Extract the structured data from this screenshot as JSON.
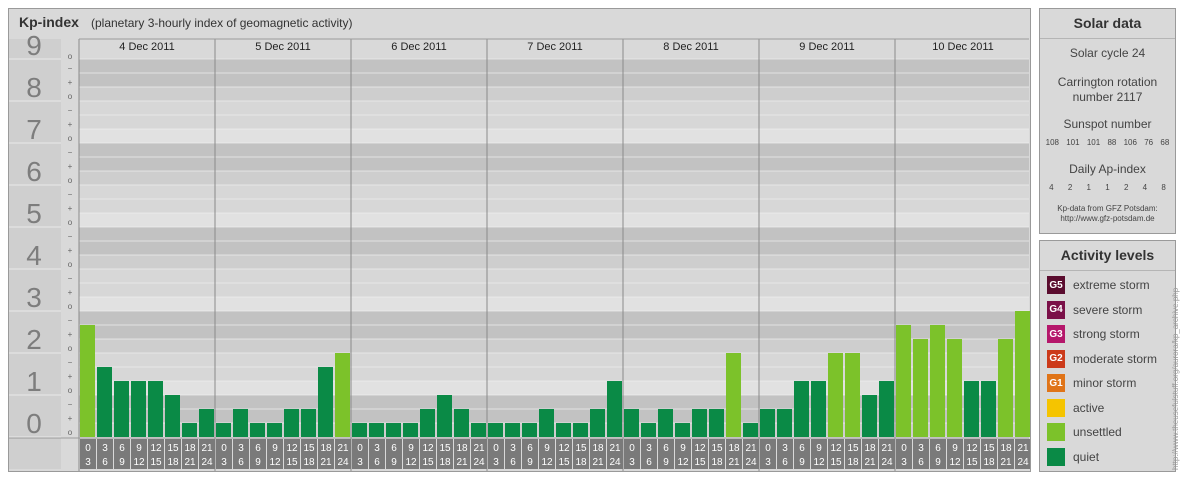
{
  "header": {
    "title": "Kp-index",
    "subtitle": "(planetary 3-hourly index of geomagnetic activity)"
  },
  "chart_data": {
    "type": "bar",
    "title": "Kp-index",
    "subtitle": "(planetary 3-hourly index of geomagnetic activity)",
    "ylim": [
      0,
      9
    ],
    "y_major_ticks": [
      "0",
      "1",
      "2",
      "3",
      "4",
      "5",
      "6",
      "7",
      "8",
      "9"
    ],
    "y_minor_ticks": [
      "o",
      "+",
      "−"
    ],
    "days": [
      "4 Dec 2011",
      "5 Dec 2011",
      "6 Dec 2011",
      "7 Dec 2011",
      "8 Dec 2011",
      "9 Dec 2011",
      "10 Dec 2011"
    ],
    "interval_start": [
      "0",
      "3",
      "6",
      "9",
      "12",
      "15",
      "18",
      "21"
    ],
    "interval_end": [
      "3",
      "6",
      "9",
      "12",
      "15",
      "18",
      "21",
      "24"
    ],
    "values": [
      [
        2.667,
        1.667,
        1.333,
        1.333,
        1.333,
        1.0,
        0.333,
        0.667
      ],
      [
        0.333,
        0.667,
        0.333,
        0.333,
        0.667,
        0.667,
        1.667,
        2.0
      ],
      [
        0.333,
        0.333,
        0.333,
        0.333,
        0.667,
        1.0,
        0.667,
        0.333
      ],
      [
        0.333,
        0.333,
        0.333,
        0.667,
        0.333,
        0.333,
        0.667,
        1.333
      ],
      [
        0.667,
        0.333,
        0.667,
        0.333,
        0.667,
        0.667,
        2.0,
        0.333
      ],
      [
        0.667,
        0.667,
        1.333,
        1.333,
        2.0,
        2.0,
        1.0,
        1.333
      ],
      [
        2.667,
        2.333,
        2.667,
        2.333,
        1.333,
        1.333,
        2.333,
        3.0
      ]
    ],
    "legend": "right"
  },
  "solar": {
    "title": "Solar data",
    "cycle": "Solar cycle 24",
    "carrington": "Carrington rotation number 2117",
    "sunspot_label": "Sunspot number",
    "sunspot_values": [
      "108",
      "101",
      "101",
      "88",
      "106",
      "76",
      "68"
    ],
    "ap_label": "Daily Ap-index",
    "ap_values": [
      "4",
      "2",
      "1",
      "1",
      "2",
      "4",
      "8"
    ],
    "source_1": "Kp-data from GFZ Potsdam:",
    "source_2": "http://www.gfz-potsdam.de"
  },
  "levels": {
    "title": "Activity levels",
    "items": [
      {
        "badge": "G5",
        "label": "extreme storm",
        "color": "#5a0c2e"
      },
      {
        "badge": "G4",
        "label": "severe storm",
        "color": "#7a1048"
      },
      {
        "badge": "G3",
        "label": "strong storm",
        "color": "#b5176b"
      },
      {
        "badge": "G2",
        "label": "moderate storm",
        "color": "#cc3a1a"
      },
      {
        "badge": "G1",
        "label": "minor storm",
        "color": "#e07418"
      },
      {
        "badge": "",
        "label": "active",
        "color": "#f5c400"
      },
      {
        "badge": "",
        "label": "unsettled",
        "color": "#7cc22a"
      },
      {
        "badge": "",
        "label": "quiet",
        "color": "#0a8a46"
      }
    ]
  },
  "watermark": "http://www.theusefulstuff.org/aurora/kp_archive.php"
}
